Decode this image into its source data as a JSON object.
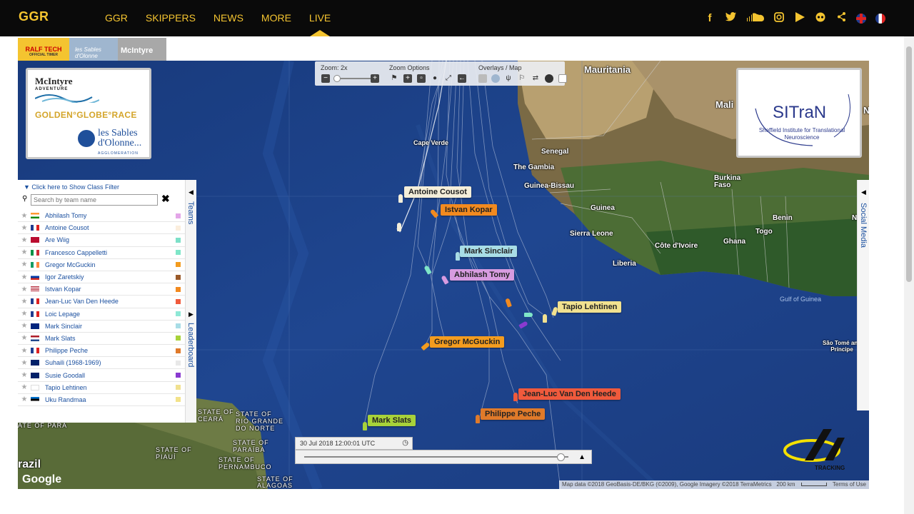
{
  "nav": {
    "logo": "GGR",
    "items": [
      {
        "label": "GGR",
        "active": false
      },
      {
        "label": "SKIPPERS",
        "active": false
      },
      {
        "label": "NEWS",
        "active": false
      },
      {
        "label": "MORE",
        "active": false
      },
      {
        "label": "LIVE",
        "active": true
      }
    ],
    "social_icons": [
      "facebook-icon",
      "twitter-icon",
      "soundcloud-icon",
      "instagram-icon",
      "youtube-icon",
      "flickr-icon",
      "share-icon"
    ],
    "languages": [
      "uk-flag",
      "fr-flag"
    ]
  },
  "sponsors": {
    "ralf_tech": "RALF TECH",
    "ralf_tech_sub": "OFFICIAL TIMER",
    "les_sables": "les Sables d'Olonne",
    "mcintyre": "McIntyre"
  },
  "toolbar": {
    "zoom_label": "Zoom: 2x",
    "zoom_options_label": "Zoom Options",
    "overlays_label": "Overlays / Map"
  },
  "logo_panel": {
    "mcintyre": "McIntyre",
    "mcintyre_sub": "ADVENTURE",
    "ggr": "GOLDEN°GLOBE°RACE",
    "les_sables": "les Sables d'Olonne...",
    "les_sables_sub": "AGGLOMERATION"
  },
  "sitran": {
    "title": "SITraN",
    "subtitle": "Sheffield Institute for Translational Neuroscience"
  },
  "map_places": {
    "mauritania": "Mauritania",
    "mali": "Mali",
    "cape_verde": "Cape Verde",
    "senegal": "Senegal",
    "gambia": "The Gambia",
    "guinea_bissau": "Guinea-Bissau",
    "guinea": "Guinea",
    "sierra_leone": "Sierra Leone",
    "liberia": "Liberia",
    "cote_divoire": "Côte d'Ivoire",
    "ghana": "Ghana",
    "togo": "Togo",
    "benin": "Benin",
    "burkina": "Burkina Faso",
    "gulf": "Gulf of Guinea",
    "sao_tome": "São Tomé and Príncipe",
    "ceara": "STATE OF CEARÁ",
    "rgn": "STATE OF RIO GRANDE DO NORTE",
    "para": "ATE OF PARÁ",
    "paraiba": "STATE OF PARAÍBA",
    "piaui": "STATE OF PIAUÍ",
    "pernambuco": "STATE OF PERNAMBUCO",
    "alagoas": "STATE OF ALAGOAS",
    "brazil": "razil",
    "nig": "Ni",
    "n": "N"
  },
  "boats": [
    {
      "name": "Antoine Cousot",
      "color": "#f4eed9"
    },
    {
      "name": "Istvan Kopar",
      "color": "#f28a1f"
    },
    {
      "name": "Mark Sinclair",
      "color": "#a8dde6"
    },
    {
      "name": "Abhilash Tomy",
      "color": "#d79be0"
    },
    {
      "name": "Tapio Lehtinen",
      "color": "#f1e190"
    },
    {
      "name": "Gregor McGuckin",
      "color": "#f39c1f"
    },
    {
      "name": "Jean-Luc Van Den Heede",
      "color": "#f05a3c"
    },
    {
      "name": "Philippe Peche",
      "color": "#e07a2a"
    },
    {
      "name": "Mark Slats",
      "color": "#a8d23a"
    }
  ],
  "teams_panel": {
    "class_filter": "Click here to Show Class Filter",
    "search_placeholder": "Search by team name",
    "teams_tab": "Teams",
    "leaderboard_tab": "Leaderboard",
    "teams": [
      {
        "name": "Abhilash Tomy",
        "flag": "in",
        "color": "#e3a6e8"
      },
      {
        "name": "Antoine Cousot",
        "flag": "fr",
        "color": "#fbeedd"
      },
      {
        "name": "Are Wiig",
        "flag": "no",
        "color": "#7de0c8"
      },
      {
        "name": "Francesco Cappelletti",
        "flag": "it",
        "color": "#7fe6c8"
      },
      {
        "name": "Gregor McGuckin",
        "flag": "ie",
        "color": "#f39c1f"
      },
      {
        "name": "Igor Zaretskiy",
        "flag": "ru",
        "color": "#9a5a2a"
      },
      {
        "name": "Istvan Kopar",
        "flag": "us",
        "color": "#f28a1f"
      },
      {
        "name": "Jean-Luc Van Den Heede",
        "flag": "fr",
        "color": "#f05a3c"
      },
      {
        "name": "Loic Lepage",
        "flag": "fr",
        "color": "#8fe8d6"
      },
      {
        "name": "Mark Sinclair",
        "flag": "au",
        "color": "#a8dde6"
      },
      {
        "name": "Mark Slats",
        "flag": "nl",
        "color": "#a8d23a"
      },
      {
        "name": "Philippe Peche",
        "flag": "fr",
        "color": "#e07a2a"
      },
      {
        "name": "Suhaili (1968-1969)",
        "flag": "gb",
        "color": "#e8e8e8"
      },
      {
        "name": "Susie Goodall",
        "flag": "gb",
        "color": "#8a3ad0"
      },
      {
        "name": "Tapio Lehtinen",
        "flag": "fi",
        "color": "#f1e190"
      },
      {
        "name": "Uku Randmaa",
        "flag": "ee",
        "color": "#f3e28a"
      }
    ]
  },
  "social_tab": "Social Media",
  "timeline": {
    "datetime": "30 Jul 2018 12:00:01 UTC",
    "progress": 0.97
  },
  "map_footer": {
    "google": "Google",
    "attribution": "Map data ©2018 GeoBasis-DE/BKG (©2009), Google Imagery ©2018 TerraMetrics",
    "scale": "200 km",
    "terms": "Terms of Use",
    "yb_label": "TRACKING"
  }
}
